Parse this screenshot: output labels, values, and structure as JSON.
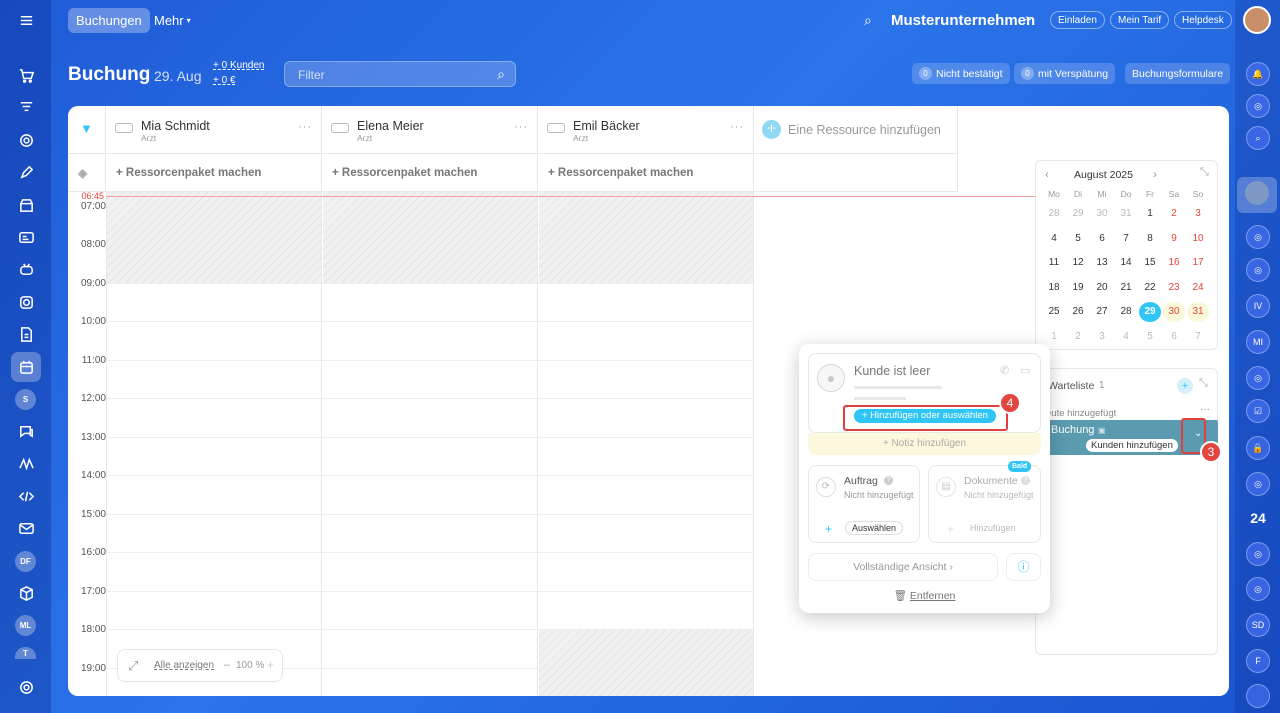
{
  "topbar": {
    "tab_active": "Buchungen",
    "tab_more": "Mehr",
    "company": "Musterunternehmen",
    "invite": "Einladen",
    "my_plan": "Mein Tarif",
    "helpdesk": "Helpdesk"
  },
  "header": {
    "title": "Buchung",
    "date": "29. Aug",
    "clients": "+ 0 Kunden",
    "money": "+ 0 €",
    "filter_placeholder": "Filter",
    "unconfirmed_count": "0",
    "unconfirmed_label": "Nicht bestätigt",
    "late_count": "0",
    "late_label": "mit Verspätung",
    "forms": "Buchungsformulare"
  },
  "leftbar": {
    "avatars": [
      "S",
      "DF",
      "ML",
      "T"
    ]
  },
  "rightbar": {
    "items": [
      "IV",
      "MI",
      "SD",
      "F"
    ],
    "count24": "24"
  },
  "resources": [
    {
      "name": "Mia Schmidt",
      "role": "Arzt"
    },
    {
      "name": "Elena Meier",
      "role": "Arzt"
    },
    {
      "name": "Emil Bäcker",
      "role": "Arzt"
    }
  ],
  "add_resource": "Eine Ressource hinzufügen",
  "package_label": "+ Ressorcenpaket machen",
  "current_time": "06:45",
  "times": [
    "07:00",
    "08:00",
    "09:00",
    "10:00",
    "11:00",
    "12:00",
    "13:00",
    "14:00",
    "15:00",
    "16:00",
    "17:00",
    "18:00",
    "19:00"
  ],
  "bottom": {
    "show_all": "Alle anzeigen",
    "zoom": "100 %"
  },
  "calendar": {
    "month": "August 2025",
    "weekdays": [
      "Mo",
      "Di",
      "Mi",
      "Do",
      "Fr",
      "Sa",
      "So"
    ],
    "weeks": [
      [
        "28",
        "29",
        "30",
        "31",
        "1",
        "2",
        "3"
      ],
      [
        "4",
        "5",
        "6",
        "7",
        "8",
        "9",
        "10"
      ],
      [
        "11",
        "12",
        "13",
        "14",
        "15",
        "16",
        "17"
      ],
      [
        "18",
        "19",
        "20",
        "21",
        "22",
        "23",
        "24"
      ],
      [
        "25",
        "26",
        "27",
        "28",
        "29",
        "30",
        "31"
      ],
      [
        "1",
        "2",
        "3",
        "4",
        "5",
        "6",
        "7"
      ]
    ],
    "selected": "29"
  },
  "waitlist": {
    "title": "Warteliste",
    "count": "1",
    "added": "eute hinzugefügt",
    "item_title": "Buchung",
    "add_client": "Kunden hinzufügen"
  },
  "popup": {
    "client_empty": "Kunde ist leer",
    "add_or_select": "+ Hinzufügen oder auswählen",
    "add_note": "+ Notiz hinzufügen",
    "order_title": "Auftrag",
    "order_status": "Nicht hinzugefügt",
    "order_action": "Auswählen",
    "docs_badge": "Bald",
    "docs_title": "Dokumente",
    "docs_status": "Nicht hinzugefügt",
    "docs_action": "Hinzufügen",
    "full_view": "Vollständige Ansicht",
    "remove": "Entfernen"
  },
  "callouts": {
    "n3": "3",
    "n4": "4"
  },
  "colors": {
    "accent": "#2fc6f6",
    "danger": "#e3453f",
    "waitlist_item": "#5a9bb0"
  }
}
